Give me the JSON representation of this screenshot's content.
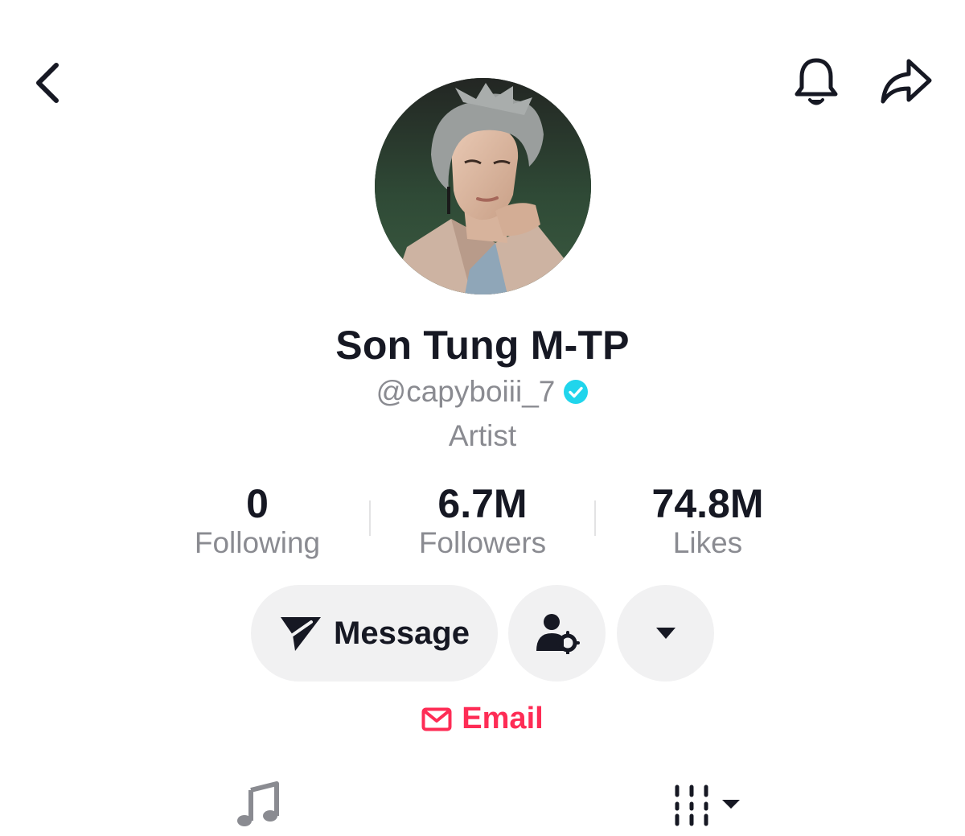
{
  "header": {
    "back_icon": "chevron-left-icon",
    "notify_icon": "bell-icon",
    "share_icon": "share-arrow-icon"
  },
  "profile": {
    "display_name": "Son Tung M-TP",
    "handle": "@capyboiii_7",
    "verified": true,
    "category": "Artist"
  },
  "stats": [
    {
      "value": "0",
      "label": "Following"
    },
    {
      "value": "6.7M",
      "label": "Followers"
    },
    {
      "value": "74.8M",
      "label": "Likes"
    }
  ],
  "actions": {
    "message_label": "Message",
    "email_label": "Email"
  },
  "tabs": {
    "music_icon": "music-note-icon",
    "playlist_icon": "playlist-sort-icon"
  },
  "colors": {
    "text_primary": "#161823",
    "text_secondary": "#8a8b91",
    "button_bg": "#f1f1f2",
    "verified_blue": "#20d5ec",
    "email_red": "#fe2c55"
  }
}
